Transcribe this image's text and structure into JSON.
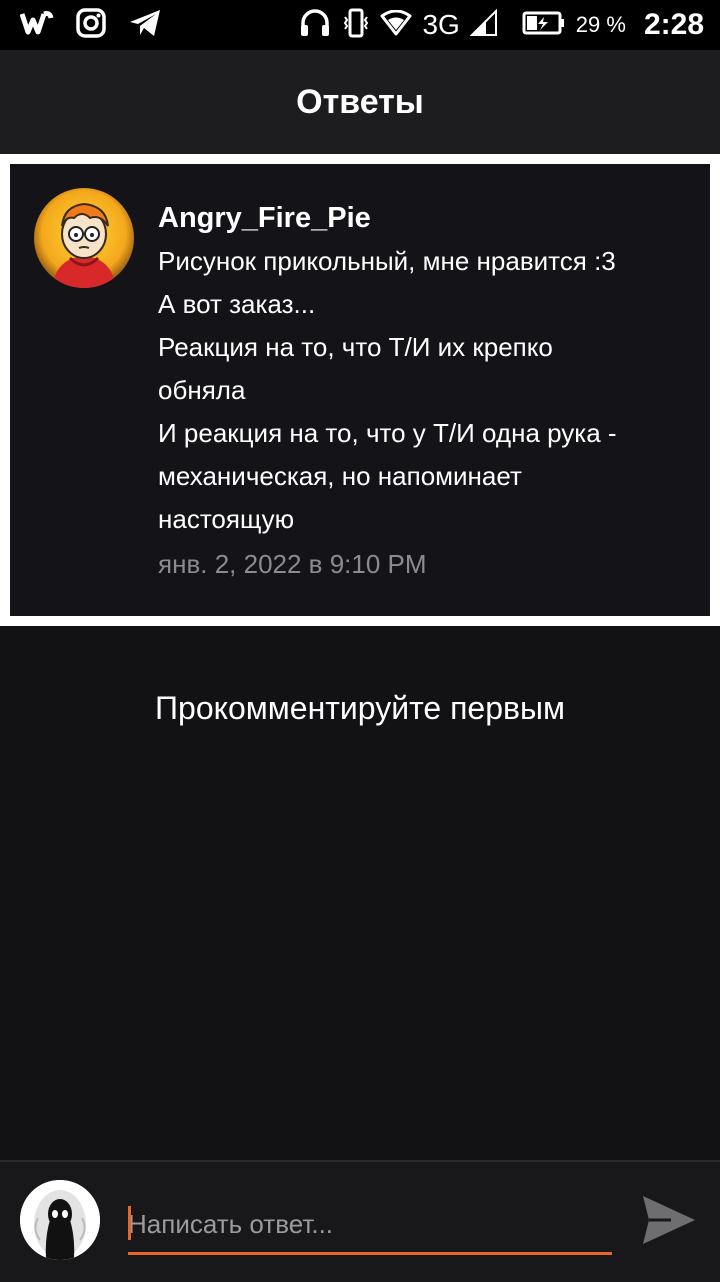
{
  "status_bar": {
    "network": "3G",
    "battery_percent": "29 %",
    "time": "2:28"
  },
  "header": {
    "title": "Ответы"
  },
  "comment": {
    "username": "Angry_Fire_Pie",
    "lines": [
      "Рисунок прикольный, мне нравится :3",
      "А вот заказ...",
      "Реакция на то, что Т/И их крепко",
      "обняла",
      "И реакция на то, что у Т/И одна рука -",
      "механическая, но напоминает",
      "настоящую"
    ],
    "date": "янв. 2, 2022 в 9:10 PM"
  },
  "empty_state": {
    "text": "Прокомментируйте первым"
  },
  "reply_bar": {
    "placeholder": "Написать ответ..."
  },
  "colors": {
    "accent": "#e8662c",
    "background": "#121114",
    "header": "#1d1c1f"
  }
}
